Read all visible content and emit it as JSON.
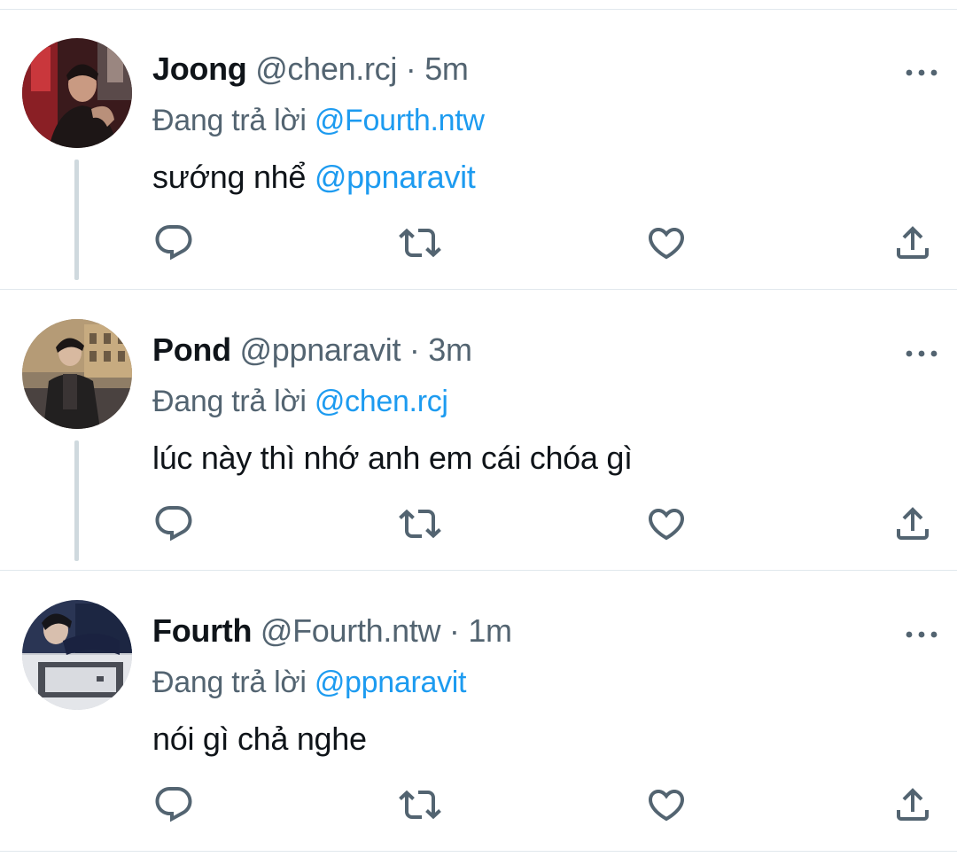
{
  "reply_prefix": "Đang trả lời",
  "colors": {
    "text": "#0f1419",
    "secondary": "#536471",
    "link": "#1d9bf0",
    "divider": "#e1e8ed",
    "thread": "#cfd9de"
  },
  "tweets": [
    {
      "name": "Joong",
      "handle": "@chen.rcj",
      "separator": "·",
      "time": "5m",
      "reply_to": "@Fourth.ntw",
      "body_text": "sướng nhể ",
      "body_mention": "@ppnaravit",
      "has_thread_line": true,
      "icons": [
        "reply-icon",
        "retweet-icon",
        "like-icon",
        "share-icon",
        "more-icon"
      ]
    },
    {
      "name": "Pond",
      "handle": "@ppnaravit",
      "separator": "·",
      "time": "3m",
      "reply_to": "@chen.rcj",
      "body_text": "lúc này thì nhớ anh em cái chóa gì",
      "body_mention": "",
      "has_thread_line": true,
      "icons": [
        "reply-icon",
        "retweet-icon",
        "like-icon",
        "share-icon",
        "more-icon"
      ]
    },
    {
      "name": "Fourth",
      "handle": "@Fourth.ntw",
      "separator": "·",
      "time": "1m",
      "reply_to": "@ppnaravit",
      "body_text": "nói gì chả nghe",
      "body_mention": "",
      "has_thread_line": false,
      "icons": [
        "reply-icon",
        "retweet-icon",
        "like-icon",
        "share-icon",
        "more-icon"
      ]
    }
  ]
}
